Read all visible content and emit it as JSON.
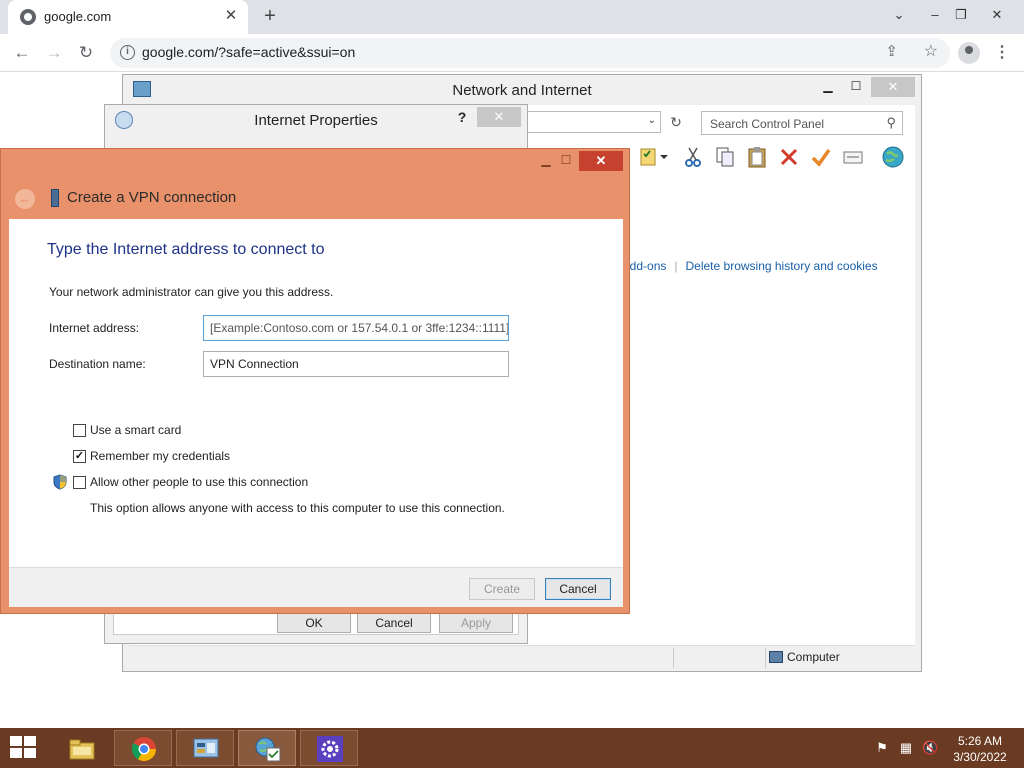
{
  "browser": {
    "tab_title": "google.com",
    "url": "google.com/?safe=active&ssui=on",
    "icons": [
      "globe-icon",
      "close-icon",
      "plus-icon",
      "back-icon",
      "forward-icon",
      "reload-icon",
      "info-icon",
      "share-icon",
      "star-icon",
      "profile-icon",
      "kebab-menu-icon"
    ]
  },
  "network_window": {
    "title": "Network and Internet",
    "search_placeholder": "Search Control Panel",
    "links": [
      "add-ons",
      "Delete browsing history and cookies"
    ],
    "status": "Computer"
  },
  "internet_properties": {
    "title": "Internet Properties",
    "help": "?",
    "buttons": {
      "ok": "OK",
      "cancel": "Cancel",
      "apply": "Apply"
    }
  },
  "vpn_dialog": {
    "title": "Create a VPN connection",
    "instruction": "Type the Internet address to connect to",
    "description": "Your network administrator can give you this address.",
    "internet_address_label": "Internet address:",
    "internet_address_value": "[Example:Contoso.com or 157.54.0.1 or 3ffe:1234::1111]",
    "destination_name_label": "Destination name:",
    "destination_name_value": "VPN Connection",
    "options": [
      {
        "label": "Use a smart card",
        "checked": false
      },
      {
        "label": "Remember my credentials",
        "checked": true
      },
      {
        "label": "Allow other people to use this connection",
        "checked": false
      }
    ],
    "allow_note": "This option allows anyone with access to this computer to use this connection.",
    "buttons": {
      "create": "Create",
      "cancel": "Cancel"
    }
  },
  "taskbar": {
    "apps": [
      "file-explorer-icon",
      "chrome-icon",
      "control-panel-icon",
      "internet-options-icon",
      "settings-icon"
    ],
    "tray": [
      "action-center-flag-icon",
      "network-icon",
      "volume-muted-icon"
    ],
    "time": "5:26 AM",
    "date": "3/30/2022"
  },
  "colors": {
    "vpn_accent": "#e8916a",
    "taskbar": "#6b3a22",
    "link": "#1a5fa8",
    "heading": "#1e3287"
  }
}
